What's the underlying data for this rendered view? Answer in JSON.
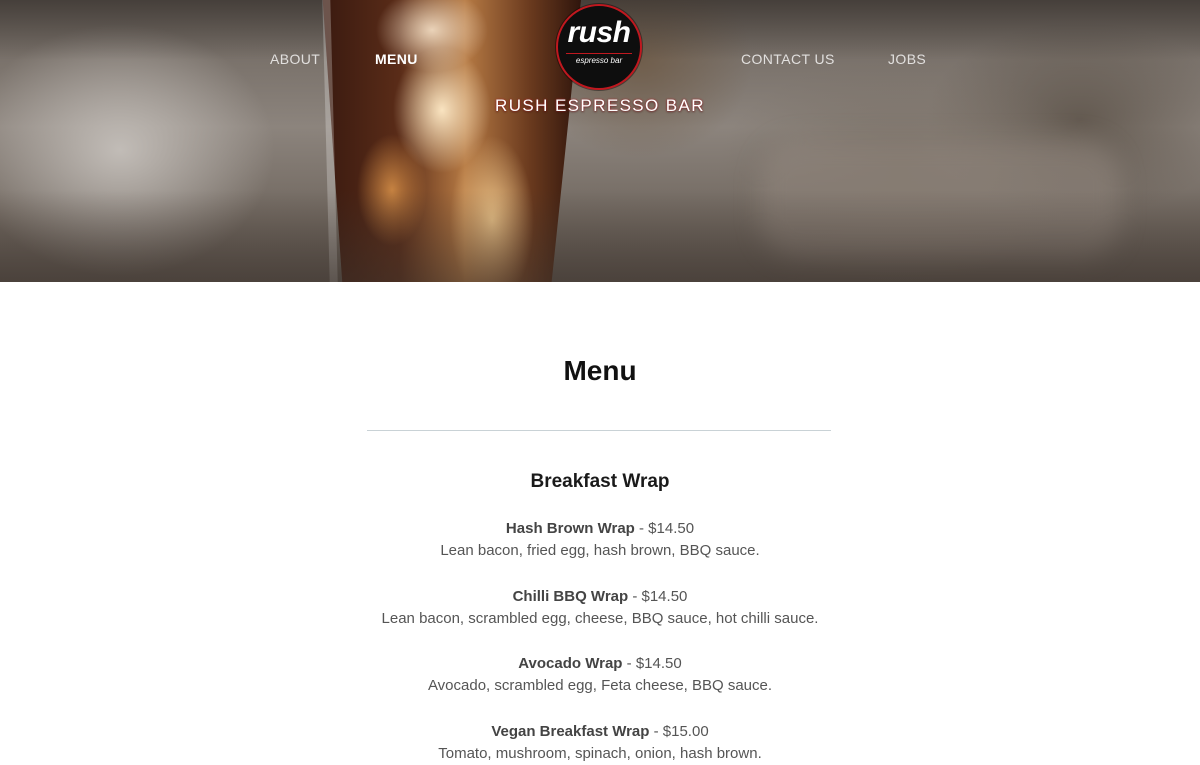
{
  "nav": {
    "about": "ABOUT",
    "menu": "MENU",
    "contact": "CONTACT US",
    "jobs": "JOBS"
  },
  "logo": {
    "word": "rush",
    "sub": "espresso bar"
  },
  "brand": "RUSH ESPRESSO BAR",
  "page": {
    "title": "Menu"
  },
  "sections": [
    {
      "title": "Breakfast Wrap",
      "items": [
        {
          "name": "Hash Brown Wrap",
          "price": "$14.50",
          "desc": "Lean bacon, fried egg, hash brown, BBQ sauce."
        },
        {
          "name": "Chilli BBQ Wrap",
          "price": "$14.50",
          "desc": "Lean bacon, scrambled egg, cheese, BBQ sauce, hot chilli sauce."
        },
        {
          "name": "Avocado Wrap",
          "price": "$14.50",
          "desc": "Avocado, scrambled egg, Feta cheese, BBQ sauce."
        },
        {
          "name": "Vegan Breakfast Wrap",
          "price": "$15.00",
          "desc": "Tomato, mushroom, spinach, onion, hash brown."
        }
      ]
    }
  ],
  "colors": {
    "logo_ring": "#c0181f",
    "text_dark": "#111111",
    "text_muted": "#555555"
  }
}
